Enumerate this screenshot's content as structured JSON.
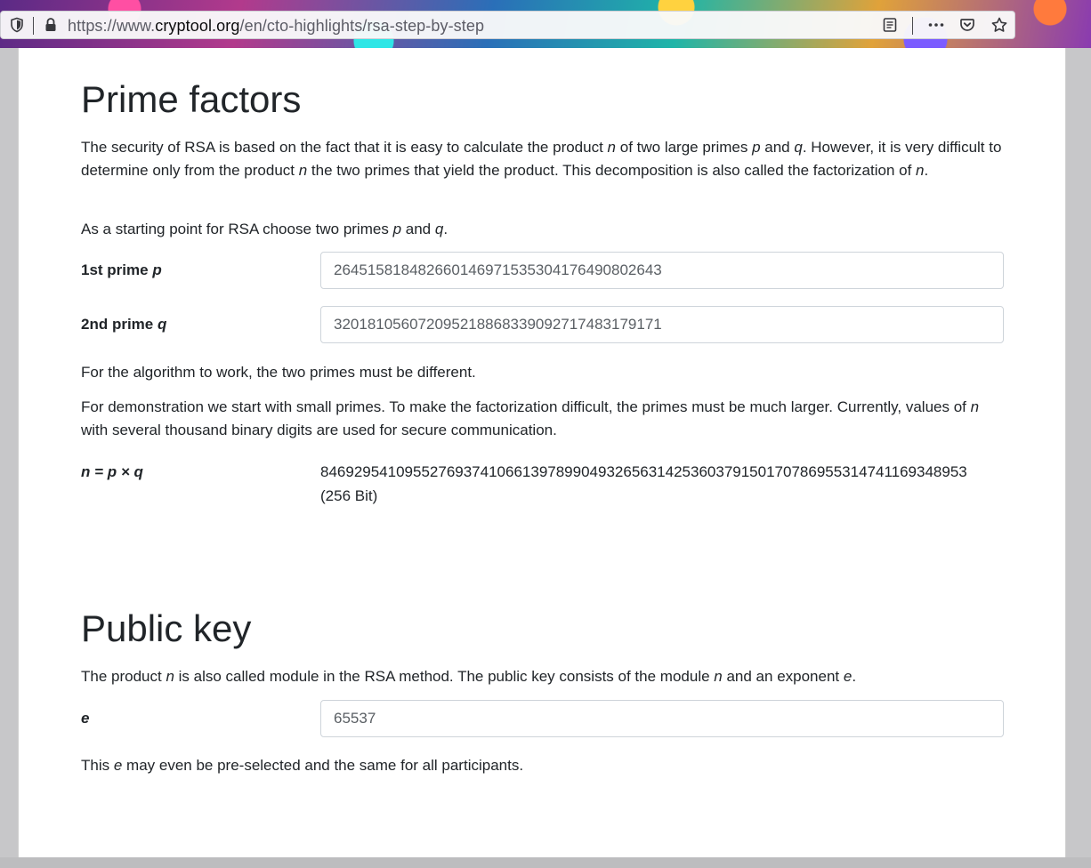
{
  "browser": {
    "url_prefix": "https://www.",
    "url_domain": "cryptool.org",
    "url_path": "/en/cto-highlights/rsa-step-by-step"
  },
  "prime_factors": {
    "heading": "Prime factors",
    "intro_part1": "The security of RSA is based on the fact that it is easy to calculate the product ",
    "intro_n1": "n",
    "intro_part2": " of two large primes ",
    "intro_p": "p",
    "intro_part3": " and ",
    "intro_q": "q",
    "intro_part4": ". However, it is very difficult to determine only from the product ",
    "intro_n2": "n",
    "intro_part5": " the two primes that yield the product. This decomposition is also called the factorization of ",
    "intro_n3": "n",
    "intro_part6": ".",
    "start_part1": "As a starting point for RSA choose two primes ",
    "start_p": "p",
    "start_and": " and ",
    "start_q": "q",
    "start_end": ".",
    "p_label": "1st prime ",
    "p_label_var": "p",
    "p_value": "264515818482660146971535304176490802643",
    "q_label": "2nd prime ",
    "q_label_var": "q",
    "q_value": "320181056072095218868339092717483179171",
    "different_note": "For the algorithm to work, the two primes must be different.",
    "demo_part1": "For demonstration we start with small primes. To make the factorization difficult, the primes must be much larger. Currently, values of ",
    "demo_n": "n",
    "demo_part2": " with several thousand binary digits are used for secure communication.",
    "n_label": "n = p × q",
    "n_value": "84692954109552769374106613978990493265631425360379150170786955314741169348953",
    "n_bits": "(256 Bit)"
  },
  "public_key": {
    "heading": "Public key",
    "desc_part1": "The product ",
    "desc_n1": "n",
    "desc_part2": " is also called module in the RSA method. The public key consists of the module ",
    "desc_n2": "n",
    "desc_part3": " and an exponent ",
    "desc_e": "e",
    "desc_part4": ".",
    "e_label": "e",
    "e_value": "65537",
    "note_part1": "This ",
    "note_e": "e",
    "note_part2": " may even be pre-selected and the same for all participants."
  }
}
